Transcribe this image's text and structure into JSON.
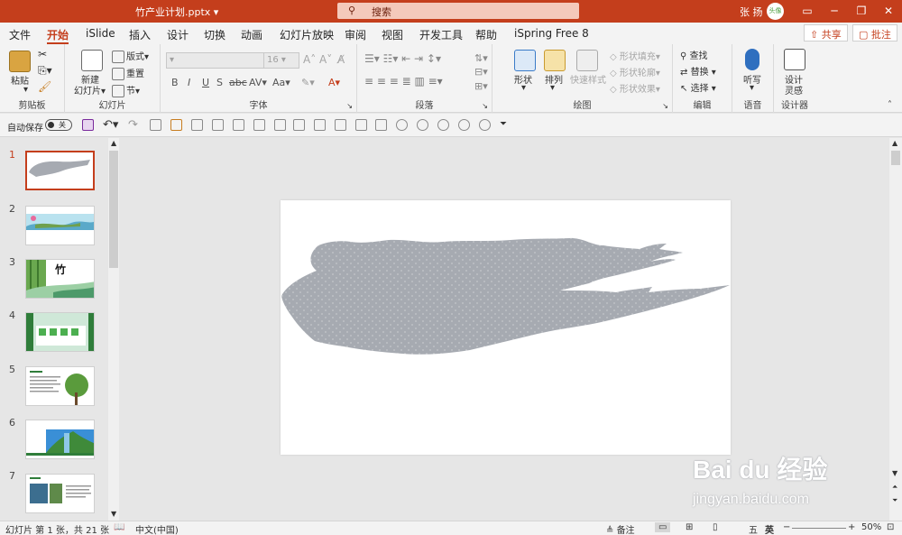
{
  "titlebar": {
    "filename": "竹产业计划.pptx",
    "search_icon": "search-icon",
    "search_placeholder": "搜索",
    "user_name": "张 扬",
    "avatar_text": "头像",
    "minimize_icon": "minimize-icon",
    "restore_icon": "restore-icon",
    "close_icon": "close-icon",
    "ribbon_display_icon": "ribbon-display-icon",
    "accent": "#c43e1c"
  },
  "menubar": {
    "tabs": [
      "文件",
      "开始",
      "iSlide",
      "插入",
      "设计",
      "切换",
      "动画",
      "幻灯片放映",
      "审阅",
      "视图",
      "开发工具",
      "帮助",
      "iSpring Free 8"
    ],
    "active": "开始",
    "share": "共享",
    "comments": "批注"
  },
  "ribbon": {
    "clipboard": {
      "paste": "粘贴",
      "label": "剪贴板"
    },
    "slides": {
      "new_slide_1": "新建",
      "new_slide_2": "幻灯片",
      "layout": "版式",
      "reset": "重置",
      "section": "节",
      "label": "幻灯片"
    },
    "font": {
      "size": "16",
      "label": "字体"
    },
    "paragraph": {
      "label": "段落"
    },
    "drawing": {
      "shapes": "形状",
      "arrange": "排列",
      "quick_styles": "快速样式",
      "fill": "形状填充",
      "outline": "形状轮廓",
      "effects": "形状效果",
      "label": "绘图"
    },
    "editing": {
      "find": "查找",
      "replace": "替换",
      "select": "选择",
      "label": "编辑"
    },
    "voice": {
      "dictate": "听写",
      "label": "语音"
    },
    "designer": {
      "line1": "设计",
      "line2": "灵感",
      "label": "设计器"
    }
  },
  "qat": {
    "autosave": "自动保存",
    "toggle": "关"
  },
  "thumbnails": [
    {
      "num": "1",
      "kind": "brush"
    },
    {
      "num": "2",
      "kind": "landscape"
    },
    {
      "num": "3",
      "kind": "bamboo-title",
      "text": "竹"
    },
    {
      "num": "4",
      "kind": "green-grid"
    },
    {
      "num": "5",
      "kind": "tree-text"
    },
    {
      "num": "6",
      "kind": "forest-banner"
    },
    {
      "num": "7",
      "kind": "photos-text"
    }
  ],
  "slide": {
    "brush_color": "#a6aab1"
  },
  "status": {
    "slide_info": "幻灯片 第 1 张，共 21 张",
    "language": "中文(中国)",
    "notes": "备注",
    "ime": "英",
    "zoom": "50%"
  },
  "watermark": {
    "brand": "Bai du 经验",
    "url": "jingyan.baidu.com"
  }
}
